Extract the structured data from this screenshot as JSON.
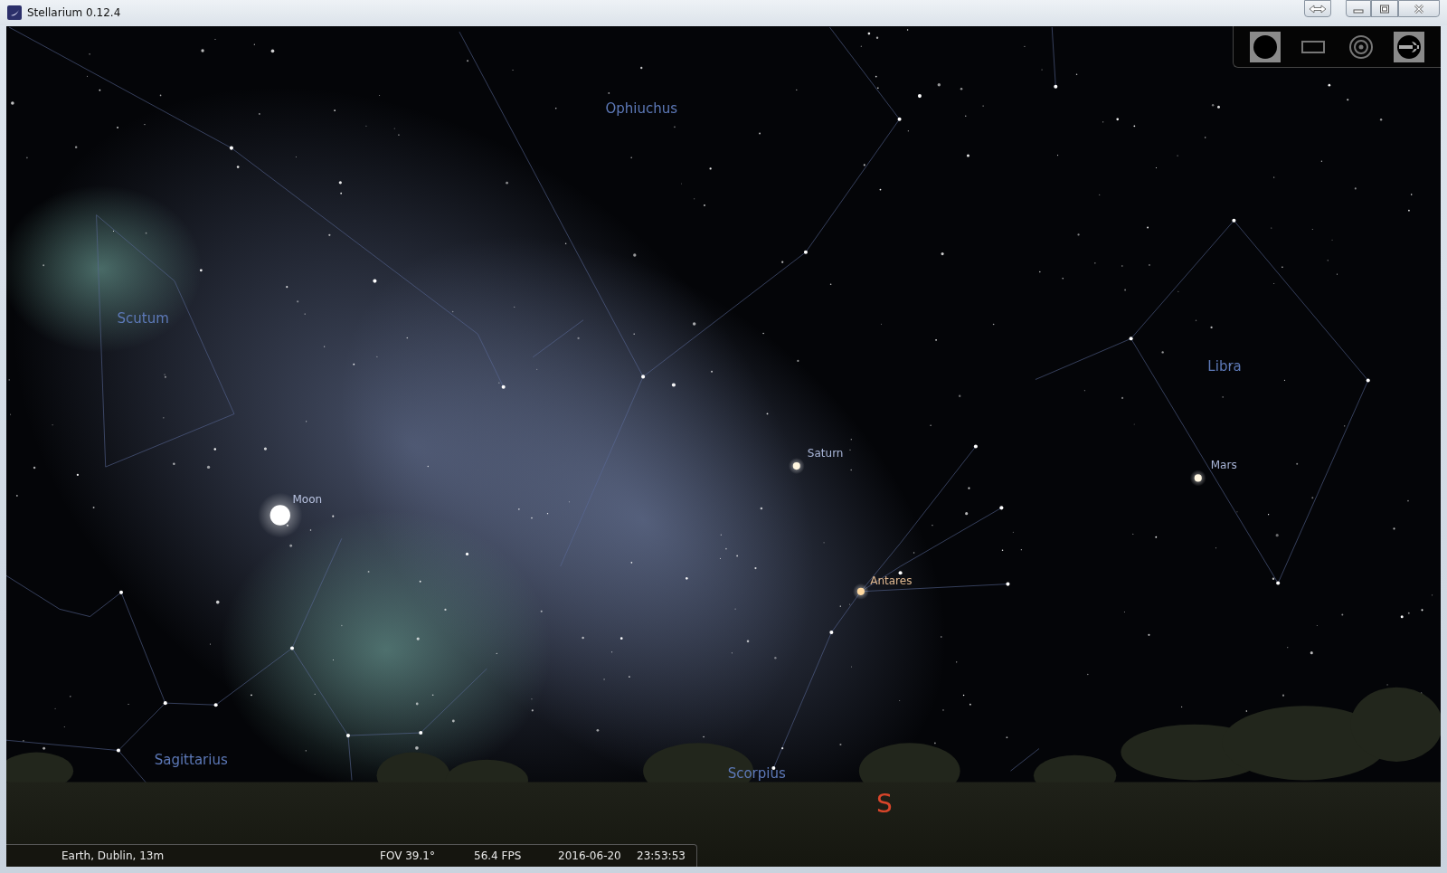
{
  "window": {
    "title": "Stellarium 0.12.4"
  },
  "sky": {
    "constellations": [
      {
        "name": "Ophiuchus"
      },
      {
        "name": "Scutum"
      },
      {
        "name": "Libra"
      },
      {
        "name": "Sagittarius"
      },
      {
        "name": "Scorpius"
      }
    ],
    "objects": [
      {
        "name": "Saturn",
        "kind": "planet"
      },
      {
        "name": "Moon",
        "kind": "moon"
      },
      {
        "name": "Antares",
        "kind": "star"
      },
      {
        "name": "Mars",
        "kind": "planet"
      }
    ],
    "cardinal": "S"
  },
  "toolbar": [
    {
      "kind": "disc",
      "on": true
    },
    {
      "kind": "frame",
      "on": false
    },
    {
      "kind": "target",
      "on": false
    },
    {
      "kind": "wrench",
      "on": true
    }
  ],
  "status_bar": {
    "location": "Earth, Dublin, 13m",
    "fov": "FOV 39.1°",
    "fps": "56.4 FPS",
    "date": "2016-06-20",
    "time": "23:53:53"
  }
}
